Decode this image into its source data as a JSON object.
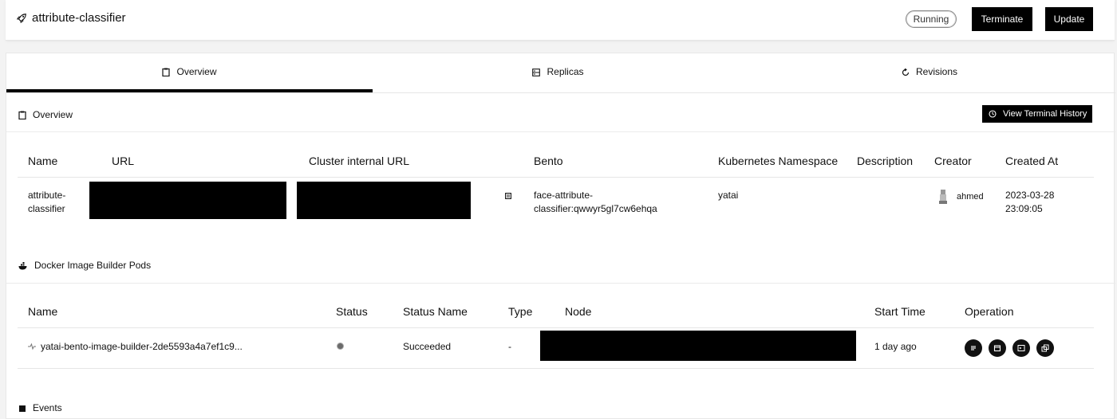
{
  "header": {
    "title": "attribute-classifier",
    "status_badge": "Running",
    "terminate_label": "Terminate",
    "update_label": "Update"
  },
  "tabs": [
    {
      "label": "Overview",
      "icon": "clipboard-icon",
      "active": true
    },
    {
      "label": "Replicas",
      "icon": "server-icon",
      "active": false
    },
    {
      "label": "Revisions",
      "icon": "refresh-icon",
      "active": false
    }
  ],
  "overview": {
    "heading": "Overview",
    "view_history_label": "View Terminal History",
    "columns": [
      "Name",
      "URL",
      "Cluster internal URL",
      "Bento",
      "Kubernetes Namespace",
      "Description",
      "Creator",
      "Created At"
    ],
    "row": {
      "name_line1": "attribute-",
      "name_line2": "classifier",
      "bento_line1": "face-attribute-",
      "bento_line2": "classifier:qwwyr5gl7cw6ehqa",
      "namespace": "yatai",
      "description": "",
      "creator": "ahmed",
      "created_date": "2023-03-28",
      "created_time": "23:09:05"
    }
  },
  "docker_pods": {
    "heading": "Docker Image Builder Pods",
    "columns": [
      "Name",
      "Status",
      "Status Name",
      "Type",
      "Node",
      "Start Time",
      "Operation"
    ],
    "row": {
      "name": "yatai-bento-image-builder-2de5593a4a7ef1c9...",
      "status_name": "Succeeded",
      "type": "-",
      "start_time": "1 day ago"
    }
  },
  "events": {
    "heading": "Events"
  },
  "colors": {
    "accent": "#000000",
    "background": "#f3f3f3",
    "surface": "#ffffff"
  }
}
